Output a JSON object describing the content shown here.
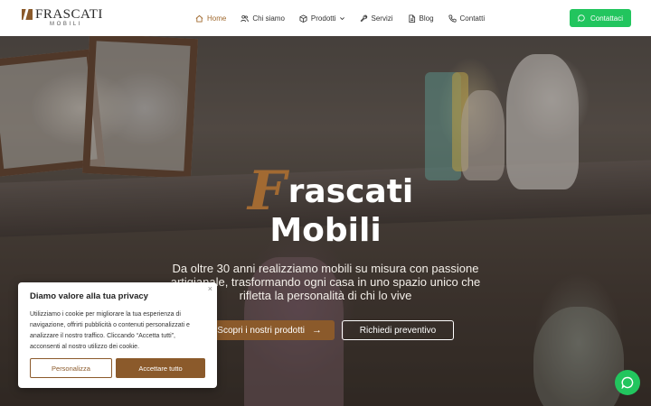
{
  "brand": {
    "name": "FRASCATI",
    "subtitle": "MOBILI"
  },
  "nav": {
    "items": [
      {
        "label": "Home",
        "icon": "home-icon",
        "active": true
      },
      {
        "label": "Chi siamo",
        "icon": "users-icon",
        "active": false
      },
      {
        "label": "Prodotti",
        "icon": "box-icon",
        "active": false,
        "dropdown": true
      },
      {
        "label": "Servizi",
        "icon": "wrench-icon",
        "active": false
      },
      {
        "label": "Blog",
        "icon": "document-icon",
        "active": false
      },
      {
        "label": "Contatti",
        "icon": "phone-icon",
        "active": false
      }
    ],
    "cta_label": "Contattaci"
  },
  "hero": {
    "title_initial": "F",
    "title_rest": "rascati",
    "title_line2": "Mobili",
    "subtitle": "Da oltre 30 anni realizziamo mobili su misura con passione artigianale, trasformando ogni casa in uno spazio unico che rifletta la personalità di chi lo vive",
    "primary_button": "Scopri i nostri prodotti",
    "secondary_button": "Richiedi preventivo"
  },
  "cookie": {
    "title": "Diamo valore alla tua privacy",
    "text": "Utilizziamo i cookie per migliorare la tua esperienza di navigazione, offrirti pubblicità o contenuti personalizzati e analizzare il nostro traffico. Cliccando “Accetta tutti”, acconsenti al nostro utilizzo dei cookie.",
    "close": "×",
    "customize_label": "Personalizza",
    "accept_label": "Accettare tutto"
  },
  "colors": {
    "accent": "#8b5a2b",
    "active_nav": "#a0692e",
    "cta_green": "#22c55e"
  }
}
